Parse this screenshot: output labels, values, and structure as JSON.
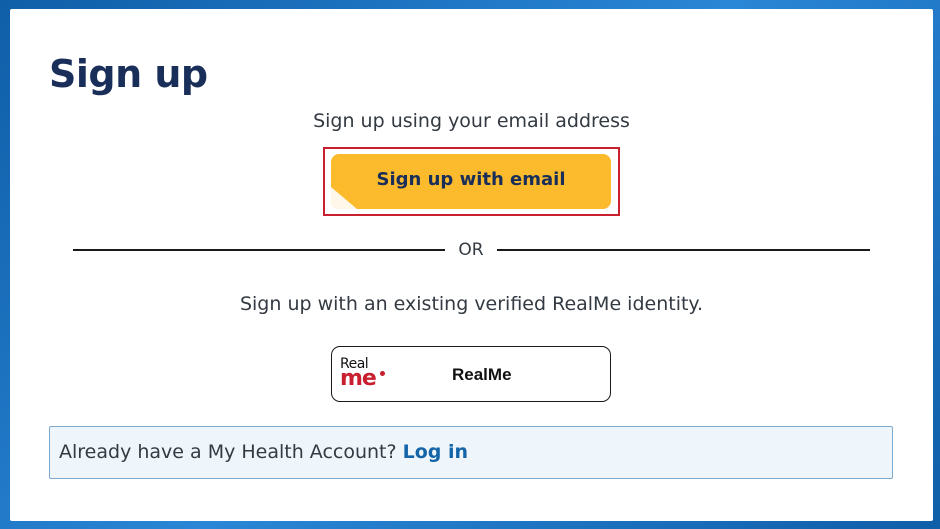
{
  "page": {
    "title": "Sign up"
  },
  "email_section": {
    "intro": "Sign up using your email address",
    "button_label": "Sign up with email"
  },
  "divider": {
    "text": "OR"
  },
  "realme_section": {
    "intro": "Sign up with an existing verified RealMe identity.",
    "logo_top": "Real",
    "logo_bottom": "me",
    "button_label": "RealMe"
  },
  "login_prompt": {
    "text": "Already have a My Health Account?",
    "link_label": "Log in"
  },
  "colors": {
    "background_blue": "#1d74c4",
    "title_navy": "#1a2e5a",
    "button_yellow": "#fbbb2c",
    "highlight_red": "#c8202f",
    "link_blue": "#1465a8",
    "panel_bg": "#eef5fb"
  }
}
